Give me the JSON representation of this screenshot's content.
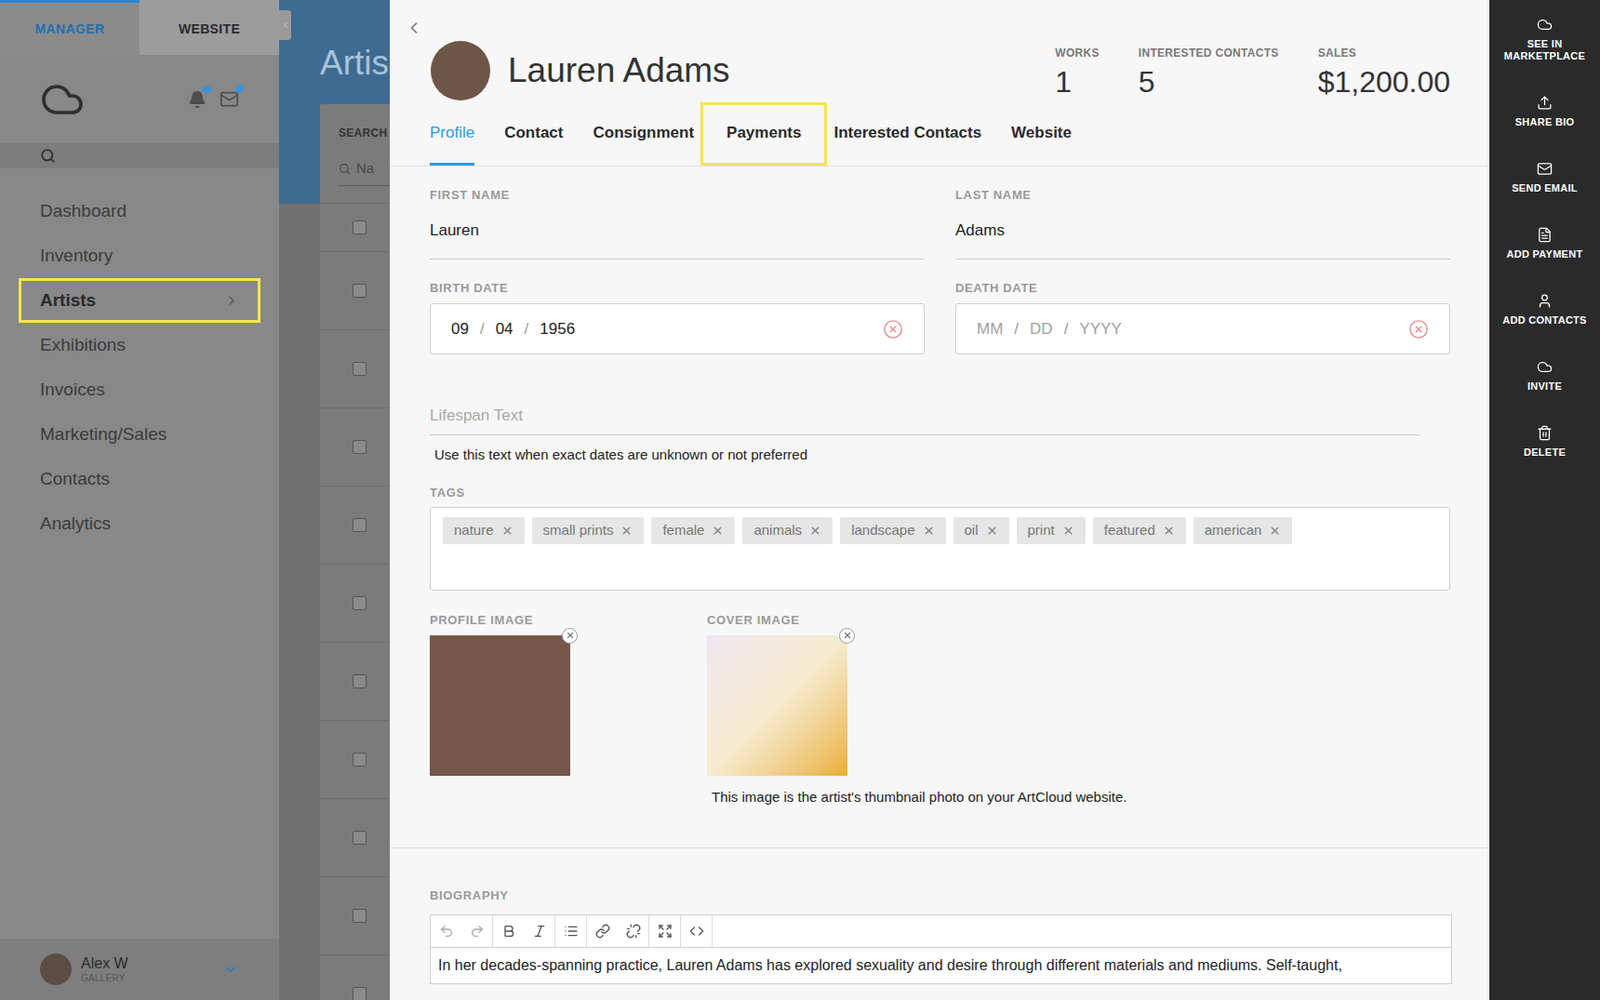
{
  "sidebar": {
    "tabs": [
      {
        "label": "MANAGER",
        "selected": true
      },
      {
        "label": "WEBSITE",
        "selected": false
      }
    ],
    "notifications": {
      "bell_unread": true,
      "mail_unread": true
    },
    "items": [
      {
        "label": "Dashboard",
        "selected": false,
        "highlighted": false
      },
      {
        "label": "Inventory",
        "selected": false,
        "highlighted": false
      },
      {
        "label": "Artists",
        "selected": true,
        "highlighted": true
      },
      {
        "label": "Exhibitions",
        "selected": false,
        "highlighted": false
      },
      {
        "label": "Invoices",
        "selected": false,
        "highlighted": false
      },
      {
        "label": "Marketing/Sales",
        "selected": false,
        "highlighted": false
      },
      {
        "label": "Contacts",
        "selected": false,
        "highlighted": false
      },
      {
        "label": "Analytics",
        "selected": false,
        "highlighted": false
      }
    ],
    "user": {
      "name": "Alex W",
      "role": "GALLERY"
    }
  },
  "background": {
    "title": "Artis",
    "search_label": "SEARCH",
    "search_placeholder": "Na",
    "header_checked": false,
    "rows": [
      {
        "checked": false
      },
      {
        "checked": false
      },
      {
        "checked": false
      },
      {
        "checked": false
      },
      {
        "checked": false
      },
      {
        "checked": false
      },
      {
        "checked": false
      },
      {
        "checked": false
      },
      {
        "checked": false
      },
      {
        "checked": false
      }
    ]
  },
  "artist": {
    "name": "Lauren Adams",
    "stats": [
      {
        "label": "WORKS",
        "value": "1"
      },
      {
        "label": "INTERESTED CONTACTS",
        "value": "5"
      },
      {
        "label": "SALES",
        "value": "$1,200.00"
      }
    ]
  },
  "tabs": [
    {
      "label": "Profile",
      "selected": true,
      "highlighted": false
    },
    {
      "label": "Contact",
      "selected": false,
      "highlighted": false
    },
    {
      "label": "Consignment",
      "selected": false,
      "highlighted": false
    },
    {
      "label": "Payments",
      "selected": false,
      "highlighted": true
    },
    {
      "label": "Interested Contacts",
      "selected": false,
      "highlighted": false
    },
    {
      "label": "Website",
      "selected": false,
      "highlighted": false
    }
  ],
  "form": {
    "first_name": {
      "label": "FIRST NAME",
      "value": "Lauren"
    },
    "last_name": {
      "label": "LAST NAME",
      "value": "Adams"
    },
    "birth_date": {
      "label": "BIRTH DATE",
      "month": "09",
      "day": "04",
      "year": "1956",
      "separator": "/",
      "empty": false
    },
    "death_date": {
      "label": "DEATH DATE",
      "month": "MM",
      "day": "DD",
      "year": "YYYY",
      "separator": "/",
      "empty": true
    },
    "lifespan": {
      "placeholder": "Lifespan Text",
      "help": "Use this text when exact dates are unknown or not preferred"
    },
    "tags": {
      "label": "TAGS",
      "items": [
        "nature",
        "small prints",
        "female",
        "animals",
        "landscape",
        "oil",
        "print",
        "featured",
        "american"
      ]
    },
    "profile_image": {
      "label": "PROFILE IMAGE"
    },
    "cover_image": {
      "label": "COVER IMAGE",
      "caption": "This image is the artist's thumbnail photo on your ArtCloud website."
    },
    "biography": {
      "label": "BIOGRAPHY",
      "text": "In her decades-spanning practice, Lauren Adams has explored sexuality and desire through different materials and mediums. Self-taught,"
    }
  },
  "actions": [
    {
      "label": "SEE IN MARKETPLACE",
      "icon": "cloud"
    },
    {
      "label": "SHARE BIO",
      "icon": "share"
    },
    {
      "label": "SEND EMAIL",
      "icon": "mail"
    },
    {
      "label": "ADD PAYMENT",
      "icon": "payment"
    },
    {
      "label": "ADD CONTACTS",
      "icon": "user"
    },
    {
      "label": "INVITE",
      "icon": "cloud"
    },
    {
      "label": "DELETE",
      "icon": "trash"
    }
  ]
}
